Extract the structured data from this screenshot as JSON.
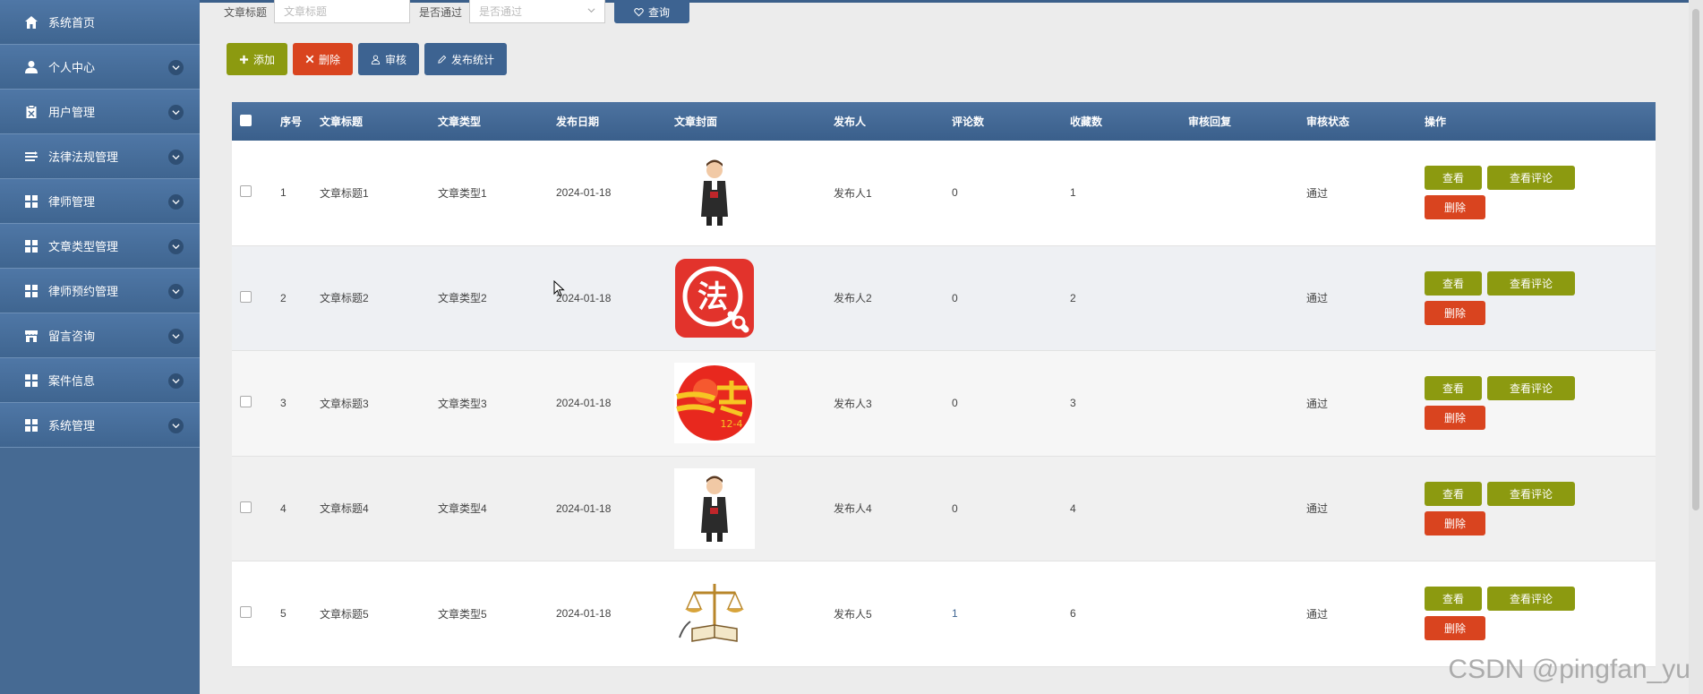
{
  "sidebar": {
    "items": [
      {
        "label": "系统首页",
        "icon": "home-icon",
        "expandable": false
      },
      {
        "label": "个人中心",
        "icon": "user-icon",
        "expandable": true
      },
      {
        "label": "用户管理",
        "icon": "clipboard-icon",
        "expandable": true
      },
      {
        "label": "法律法规管理",
        "icon": "list-icon",
        "expandable": true
      },
      {
        "label": "律师管理",
        "icon": "grid-icon",
        "expandable": true
      },
      {
        "label": "文章类型管理",
        "icon": "grid-icon",
        "expandable": true
      },
      {
        "label": "律师预约管理",
        "icon": "grid-icon",
        "expandable": true
      },
      {
        "label": "留言咨询",
        "icon": "store-icon",
        "expandable": true
      },
      {
        "label": "案件信息",
        "icon": "grid-icon",
        "expandable": true
      },
      {
        "label": "系统管理",
        "icon": "grid-icon",
        "expandable": true
      }
    ]
  },
  "search": {
    "title_label": "文章标题",
    "title_placeholder": "文章标题",
    "pass_label": "是否通过",
    "pass_placeholder": "是否通过",
    "query_label": "查询"
  },
  "toolbar": {
    "add_label": "添加",
    "delete_label": "删除",
    "audit_label": "审核",
    "stats_label": "发布统计"
  },
  "table": {
    "headers": [
      "序号",
      "文章标题",
      "文章类型",
      "发布日期",
      "文章封面",
      "发布人",
      "评论数",
      "收藏数",
      "审核回复",
      "审核状态",
      "操作"
    ],
    "rows": [
      {
        "idx": "1",
        "title": "文章标题1",
        "type": "文章类型1",
        "date": "2024-01-18",
        "cover": "lawyer-figure-image",
        "publisher": "发布人1",
        "comments": "0",
        "favorites": "1",
        "reply": "",
        "status": "通过"
      },
      {
        "idx": "2",
        "title": "文章标题2",
        "type": "文章类型2",
        "date": "2024-01-18",
        "cover": "fa-search-logo-image",
        "publisher": "发布人2",
        "comments": "0",
        "favorites": "2",
        "reply": "",
        "status": "通过"
      },
      {
        "idx": "3",
        "title": "文章标题3",
        "type": "文章类型3",
        "date": "2024-01-18",
        "cover": "law-day-emblem-image",
        "publisher": "发布人3",
        "comments": "0",
        "favorites": "3",
        "reply": "",
        "status": "通过"
      },
      {
        "idx": "4",
        "title": "文章标题4",
        "type": "文章类型4",
        "date": "2024-01-18",
        "cover": "lawyer-figure-image",
        "publisher": "发布人4",
        "comments": "0",
        "favorites": "4",
        "reply": "",
        "status": "通过"
      },
      {
        "idx": "5",
        "title": "文章标题5",
        "type": "文章类型5",
        "date": "2024-01-18",
        "cover": "scales-book-image",
        "publisher": "发布人5",
        "comments": "1",
        "favorites": "6",
        "reply": "",
        "status": "通过"
      }
    ],
    "ops": {
      "view": "查看",
      "view_comments": "查看评论",
      "delete": "删除"
    }
  },
  "emblem_text": {
    "fa": "法",
    "law_day": "12-4"
  },
  "watermark": "CSDN @pingfan_yu",
  "colors": {
    "sidebar": "#466a93",
    "header": "#3d6391",
    "olive": "#8c9a10",
    "danger": "#d9441f"
  }
}
